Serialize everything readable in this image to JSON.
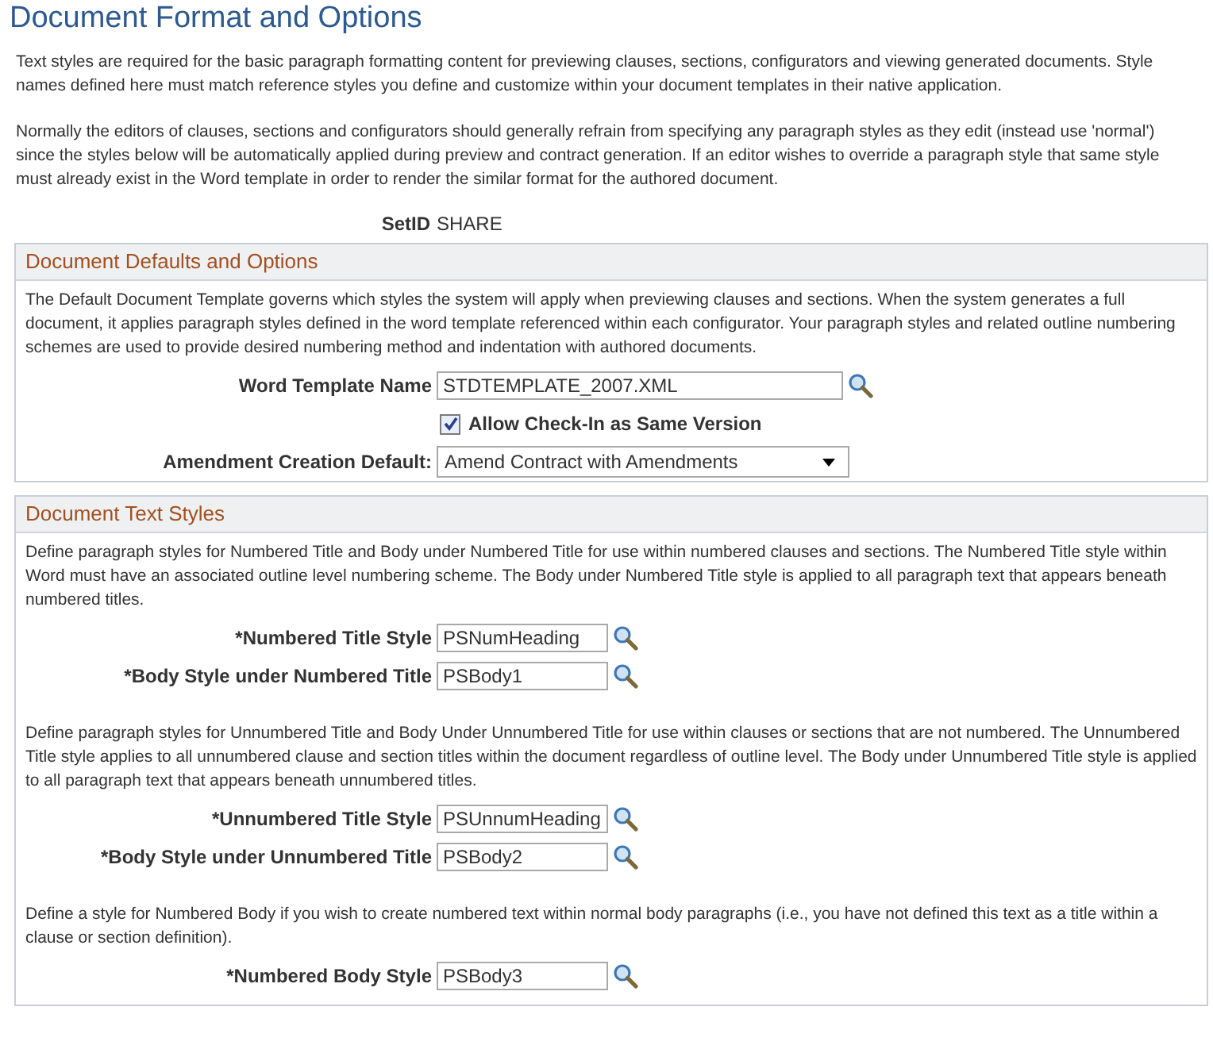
{
  "page_title": "Document Format and Options",
  "intro": [
    "Text styles are required for the basic paragraph formatting content for previewing clauses, sections, configurators and viewing generated documents. Style names defined here must match reference styles you define and customize within your document templates in their native application.",
    "Normally the editors of clauses, sections and configurators should generally refrain from specifying any paragraph styles as they edit (instead use 'normal') since the styles below will be automatically applied during preview and contract generation. If an editor wishes to override a paragraph style that same style must already exist in the Word template in order to render the similar format for the authored document."
  ],
  "setid": {
    "label": "SetID",
    "value": "SHARE"
  },
  "defaults": {
    "title": "Document Defaults and Options",
    "description": "The Default Document Template governs which styles the system will apply when previewing clauses and sections. When the system generates a full document, it applies paragraph styles defined in the word template referenced within each configurator. Your paragraph styles and related outline numbering schemes are used to provide desired numbering method and indentation with authored documents.",
    "fields": [
      {
        "kind": "lookup",
        "label": "Word Template Name",
        "value": "STDTEMPLATE_2007.XML"
      },
      {
        "kind": "checkbox",
        "label": "Allow Check-In as Same Version",
        "checked": true
      },
      {
        "kind": "dropdown",
        "label": "Amendment Creation Default:",
        "value": "Amend Contract with Amendments"
      }
    ]
  },
  "text_styles": {
    "title": "Document Text Styles",
    "groups": [
      {
        "description": "Define paragraph styles for Numbered Title and Body under Numbered Title for use within numbered clauses and sections. The Numbered Title style within Word must have an associated outline level numbering scheme. The Body under Numbered Title style is applied to all paragraph text that appears beneath numbered titles.",
        "fields": [
          {
            "label": "*Numbered Title Style",
            "value": "PSNumHeading"
          },
          {
            "label": "*Body Style under Numbered Title",
            "value": "PSBody1"
          }
        ]
      },
      {
        "description": "Define paragraph styles for Unnumbered Title and Body Under Unnumbered Title for use within clauses or sections that are not numbered. The Unnumbered Title style applies to all unnumbered clause and section titles within the document regardless of outline level. The Body under Unnumbered Title style is applied to all paragraph text that appears beneath unnumbered titles.",
        "fields": [
          {
            "label": "*Unnumbered Title Style",
            "value": "PSUnnumHeading"
          },
          {
            "label": "*Body Style under Unnumbered Title",
            "value": "PSBody2"
          }
        ]
      },
      {
        "description": "Define a style for Numbered Body if you wish to create numbered text within normal body paragraphs (i.e., you have not defined this text as a title within a clause or section definition).",
        "fields": [
          {
            "label": "*Numbered Body Style",
            "value": "PSBody3"
          }
        ]
      }
    ]
  }
}
